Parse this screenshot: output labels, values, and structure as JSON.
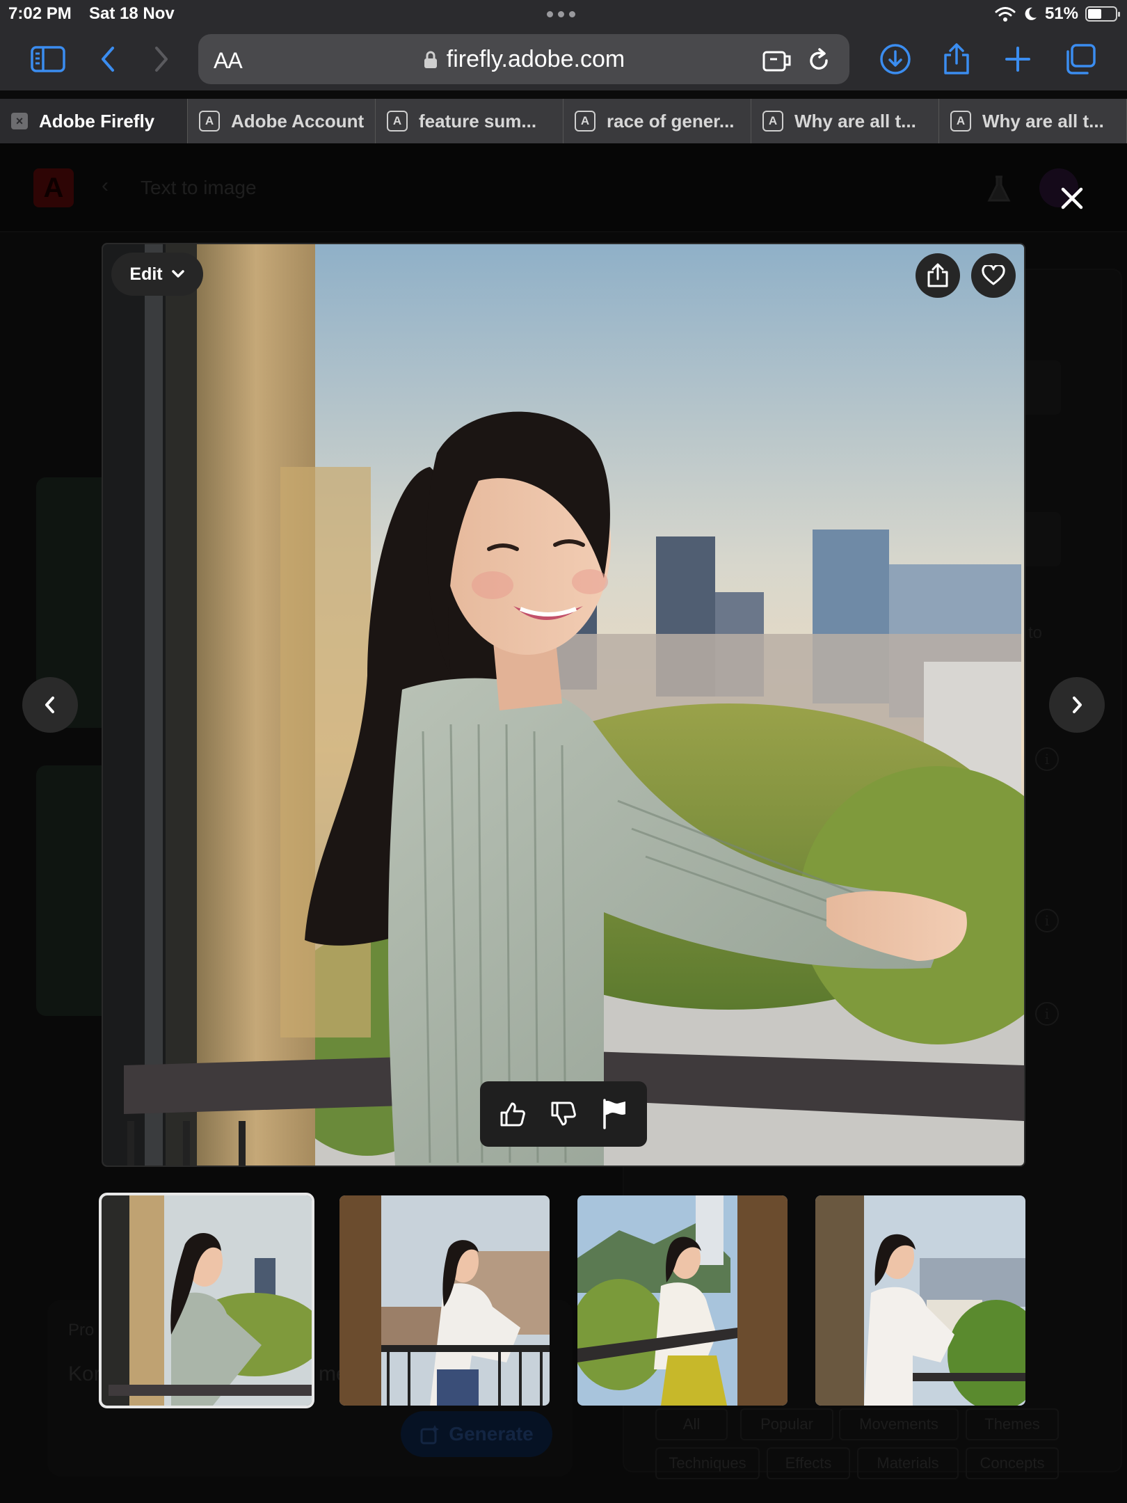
{
  "status_bar": {
    "time": "7:02 PM",
    "date": "Sat 18 Nov",
    "battery": "51%",
    "battery_level": 0.51
  },
  "browser": {
    "aa_label": "AA",
    "url": "firefly.adobe.com",
    "tabs": [
      {
        "label": "Adobe Firefly",
        "active": true
      },
      {
        "label": "Adobe Account",
        "favicon": "A"
      },
      {
        "label": "feature sum...",
        "favicon": "A"
      },
      {
        "label": "race of gener...",
        "favicon": "A"
      },
      {
        "label": "Why are all t...",
        "favicon": "A"
      },
      {
        "label": "Why are all t...",
        "favicon": "A"
      }
    ]
  },
  "background_page": {
    "header_title": "Text to image",
    "prompt_label": "Pro",
    "prompt_text": "Kor",
    "prompt_text_tail": "me",
    "generate_label": "Generate",
    "side_text_fragment": "to",
    "filters": [
      "All",
      "Popular",
      "Movements",
      "Themes",
      "Techniques",
      "Effects",
      "Materials",
      "Concepts"
    ]
  },
  "viewer": {
    "edit_label": "Edit",
    "selected_index": 0,
    "icons": {
      "close": "close-icon",
      "share": "share-icon",
      "favorite": "heart-icon",
      "like": "thumbs-up-icon",
      "dislike": "thumbs-down-icon",
      "report": "flag-icon",
      "prev": "chevron-left-icon",
      "next": "chevron-right-icon"
    },
    "thumbnails": [
      {
        "name": "variation-1"
      },
      {
        "name": "variation-2"
      },
      {
        "name": "variation-3"
      },
      {
        "name": "variation-4"
      }
    ]
  }
}
